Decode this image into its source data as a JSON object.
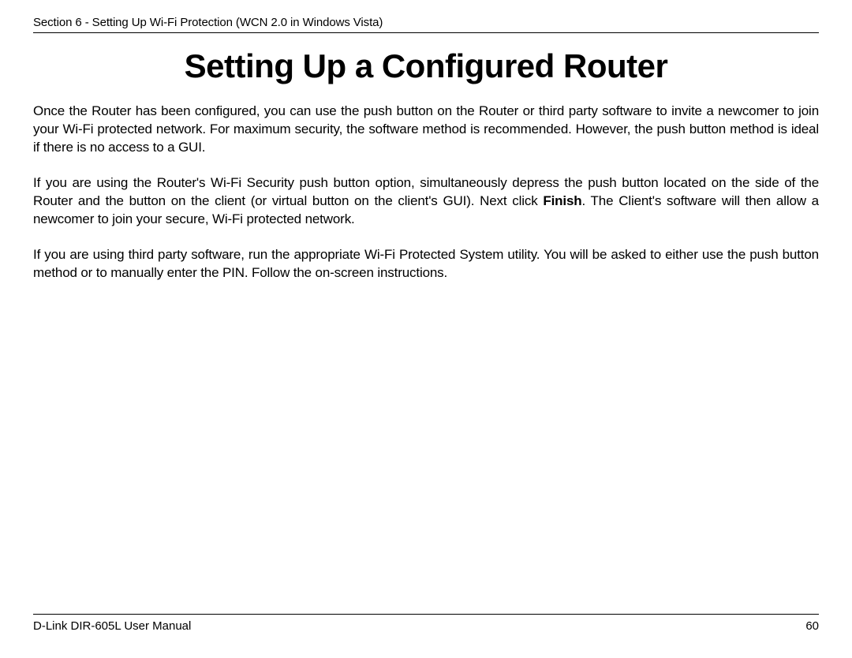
{
  "header": {
    "section_text": "Section 6 - Setting Up Wi-Fi Protection (WCN 2.0 in Windows Vista)"
  },
  "title": "Setting Up a Configured Router",
  "paragraphs": {
    "p1": "Once the Router has been configured, you can use the push button on the Router or third party software to invite a newcomer to join your Wi-Fi protected network. For maximum security, the software method is recommended. However, the push button method is ideal if there is no access to a GUI.",
    "p2_before": "If you are using the Router's Wi-Fi Security push button option, simultaneously depress the push button located on the side of the Router and the button on the client (or virtual button on the client's GUI). Next click ",
    "p2_bold": "Finish",
    "p2_after": ". The Client's software will then allow a newcomer to join your secure, Wi-Fi protected network.",
    "p3": "If you are using third party software, run the appropriate Wi-Fi Protected System utility. You will be asked to either use the push button method or to manually enter the PIN. Follow the on-screen instructions."
  },
  "footer": {
    "manual_name": "D-Link DIR-605L User Manual",
    "page_number": "60"
  }
}
